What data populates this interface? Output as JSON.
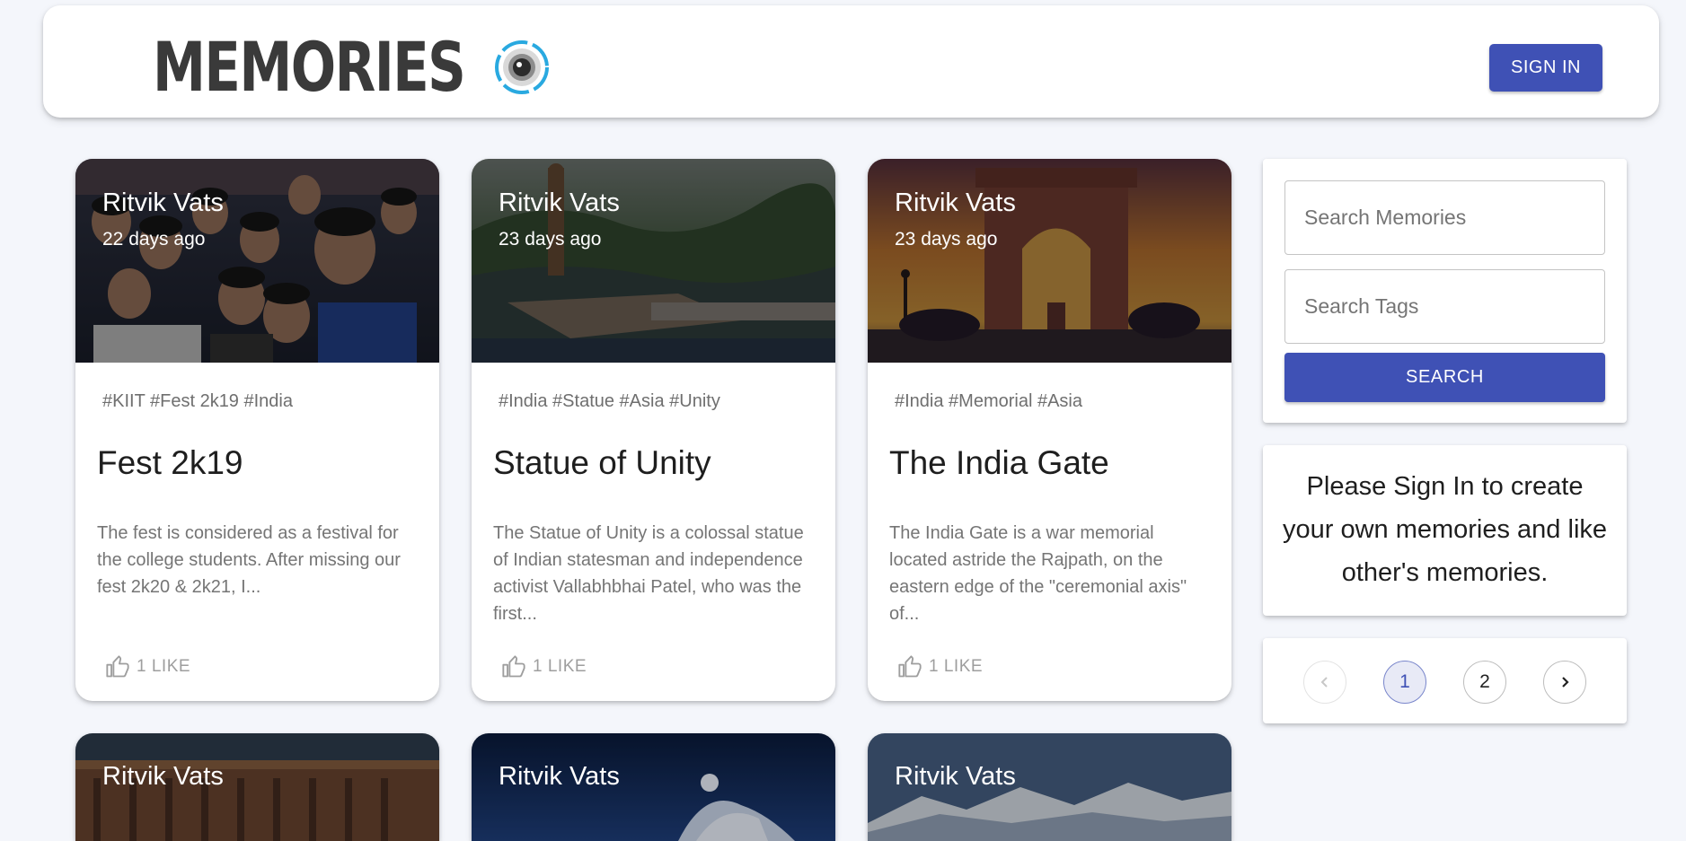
{
  "header": {
    "brand_title": "MEMORIES",
    "brand_icon": "camera-lens-icon",
    "signin_label": "SIGN IN"
  },
  "colors": {
    "primary": "#3f51b5",
    "background": "#f4f6fb",
    "lens_accent": "#29a9e0"
  },
  "posts": [
    {
      "author": "Ritvik Vats",
      "time": "22 days ago",
      "tags": "#KIIT #Fest 2k19 #India",
      "title": "Fest 2k19",
      "description": "The fest is considered as a festival for the college students. After missing our fest 2k20 & 2k21, I...",
      "likes": "1 LIKE",
      "image": "group-selfie-photo"
    },
    {
      "author": "Ritvik Vats",
      "time": "23 days ago",
      "tags": "#India #Statue #Asia #Unity",
      "title": "Statue of Unity",
      "description": "The Statue of Unity is a colossal statue of Indian statesman and independence activist Vallabhbhai Patel, who was the first...",
      "likes": "1 LIKE",
      "image": "statue-landscape-photo"
    },
    {
      "author": "Ritvik Vats",
      "time": "23 days ago",
      "tags": "#India #Memorial #Asia",
      "title": "The India Gate",
      "description": "The India Gate is a war memorial located astride the Rajpath, on the eastern edge of the \"ceremonial axis\" of...",
      "likes": "1 LIKE",
      "image": "india-gate-sunset-photo"
    }
  ],
  "posts_second_row": [
    {
      "author": "Ritvik Vats",
      "image": "parliament-building-photo"
    },
    {
      "author": "Ritvik Vats",
      "image": "opera-house-night-photo"
    },
    {
      "author": "Ritvik Vats",
      "image": "snowy-mountains-photo"
    }
  ],
  "sidebar": {
    "search_memories_placeholder": "Search Memories",
    "search_tags_placeholder": "Search Tags",
    "search_label": "SEARCH",
    "notice": "Please Sign In to create your own memories and like other's memories.",
    "pagination": {
      "pages": [
        "1",
        "2"
      ],
      "current": "1"
    }
  }
}
